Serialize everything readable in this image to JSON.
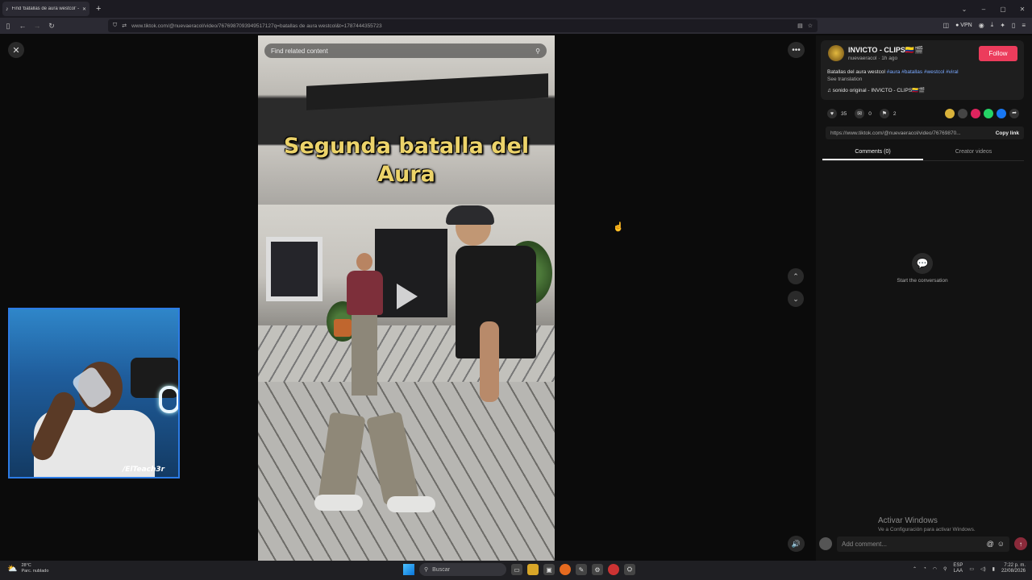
{
  "browser": {
    "tab_title": "Find 'batallas de aura westcol' - ",
    "new_tab": "+",
    "url": "www.tiktok.com/@nuevaeracol/video/7676987093949517127q=batallas de aura westcol&t=1787444355723",
    "vpn_label": "VPN",
    "win_min": "–",
    "win_max": "▢",
    "win_close": "✕"
  },
  "video": {
    "search_placeholder": "Find related content",
    "overlay_line1": "Segunda batalla del",
    "overlay_line2": "Aura"
  },
  "webcam": {
    "tag": "/ElTeach3r"
  },
  "post": {
    "username": "INVICTO - CLIPS🇨🇴🎬",
    "handle_time": "nuevaeracol · 1h ago",
    "follow_label": "Follow",
    "description": "Batallas del aura westcol",
    "tags": "#aura #batallas #westcol #viral",
    "see_translation": "See translation",
    "sound": "♫ sonido original - INVICTO - CLIPS🇨🇴🎬",
    "likes": "35",
    "comments": "0",
    "saves": "2",
    "link": "https://www.tiktok.com/@nuevaeracol/video/76769870...",
    "copy_link": "Copy link",
    "tab_comments": "Comments (0)",
    "tab_creator": "Creator videos",
    "empty_text": "Start the conversation",
    "comment_placeholder": "Add comment...",
    "share_colors": [
      "#d9b23a",
      "#444444",
      "#e0245e",
      "#25d366",
      "#1877f2"
    ]
  },
  "windows": {
    "activate_title": "Activar Windows",
    "activate_sub": "Ve a Configuración para activar Windows."
  },
  "taskbar": {
    "temp": "28°C",
    "weather": "Parc. nublado",
    "search": "Buscar",
    "lang1": "ESP",
    "lang2": "LAA",
    "time": "7:22 p. m.",
    "date": "22/08/2026"
  }
}
